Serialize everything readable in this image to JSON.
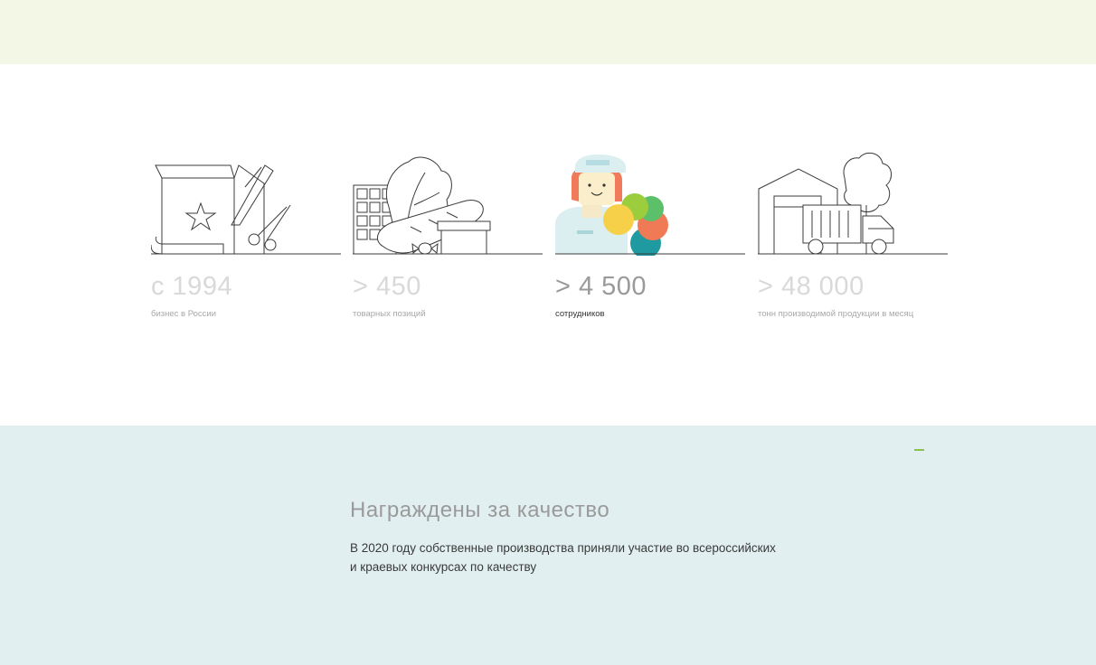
{
  "stats": [
    {
      "value": "с 1994",
      "caption": "бизнес в России",
      "icon": "gift-box-icon"
    },
    {
      "value": "> 450",
      "caption": "товарных позиций",
      "icon": "groceries-icon"
    },
    {
      "value": "> 4 500",
      "caption": "сотрудников",
      "icon": "worker-icon"
    },
    {
      "value": "> 48 000",
      "caption": "тонн производимой продукции в месяц",
      "icon": "factory-truck-icon"
    }
  ],
  "awards": {
    "title": "Награждены за качество",
    "text_line1": "В 2020 году собственные производства приняли участие во всероссийских",
    "text_line2": "и краевых конкурсах по качеству"
  },
  "colors": {
    "top_band": "#f3f7e6",
    "awards_bg": "#e2eff0",
    "accent_green": "#8bc34a",
    "line": "#444444"
  }
}
